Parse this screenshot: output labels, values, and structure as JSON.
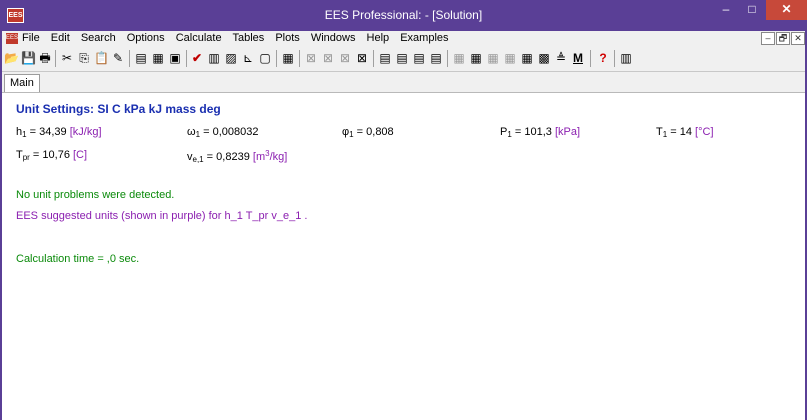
{
  "titlebar": {
    "app_icon": "EES",
    "title": "EES Professional:  - [Solution]",
    "minimize": "–",
    "maximize": "□",
    "close": "✕"
  },
  "menubar": {
    "doc_icon": "EES",
    "items": [
      "File",
      "Edit",
      "Search",
      "Options",
      "Calculate",
      "Tables",
      "Plots",
      "Windows",
      "Help",
      "Examples"
    ],
    "mdi": [
      "–",
      "🗗",
      "✕"
    ]
  },
  "tabs": [
    {
      "label": "Main"
    }
  ],
  "solution": {
    "heading": "Unit Settings: SI C kPa kJ mass deg",
    "vars": {
      "h1": {
        "name": "h",
        "sub": "1",
        "value": "34,39",
        "unit": "[kJ/kg]"
      },
      "omega1": {
        "name": "ω",
        "sub": "1",
        "value": "0,008032"
      },
      "phi1": {
        "name": "φ",
        "sub": "1",
        "value": "0,808"
      },
      "P1": {
        "name": "P",
        "sub": "1",
        "value": "101,3",
        "unit": "[kPa]"
      },
      "T1": {
        "name": "T",
        "sub": "1",
        "value": "14",
        "unit": "[°C]"
      },
      "Tpr": {
        "name": "T",
        "sub": "pr",
        "value": "10,76",
        "unit": "[C]"
      },
      "ve1": {
        "name": "v",
        "sub": "e,1",
        "value": "0,8239",
        "unit_pre": "[m",
        "unit_sup": "3",
        "unit_post": "/kg]"
      }
    },
    "no_problems": "No unit problems were detected.",
    "suggested": "EES suggested units (shown in purple) for h_1  T_pr  v_e_1  .",
    "calc_time": "Calculation time = ,0 sec."
  },
  "colors": {
    "frame": "#5a3f96",
    "heading": "#1a2fb0",
    "unit_purple": "#8b1fb0",
    "ok_green": "#0a8a0a",
    "close": "#c7493a"
  }
}
